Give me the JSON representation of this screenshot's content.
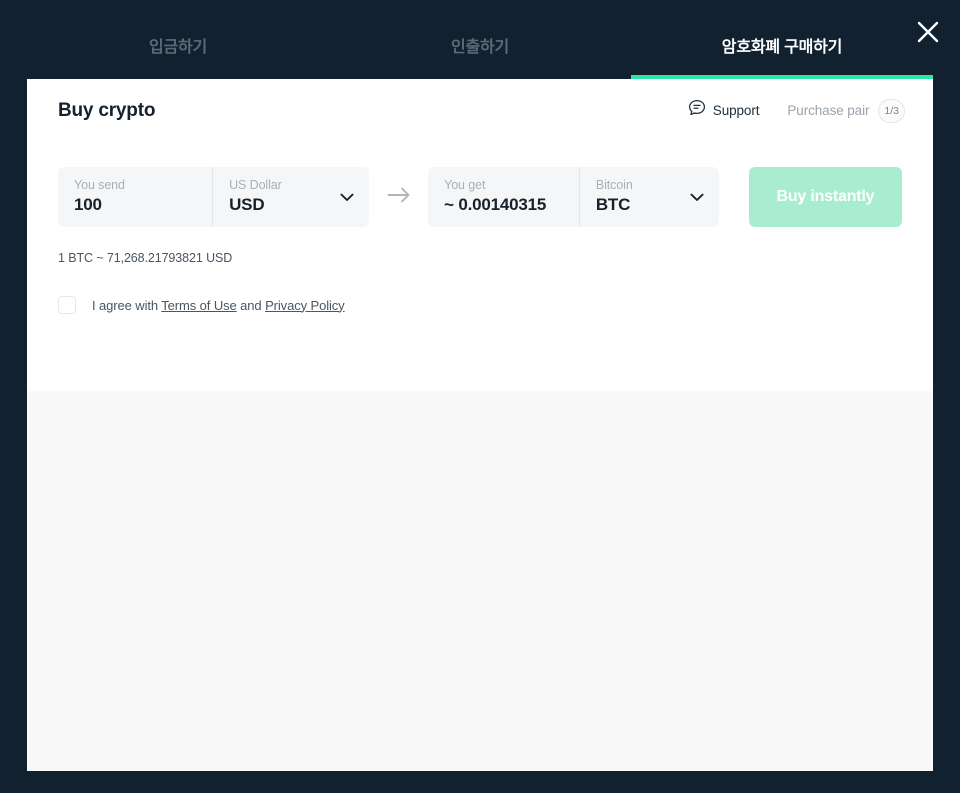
{
  "window": {
    "background_color": "#112130",
    "close_icon": "close-icon"
  },
  "tabs": [
    {
      "label": "입금하기",
      "active": false
    },
    {
      "label": "인출하기",
      "active": false
    },
    {
      "label": "암호화폐 구매하기",
      "active": true
    }
  ],
  "accent_color": "#2ee6a8",
  "header": {
    "title": "Buy crypto",
    "support": {
      "label": "Support",
      "icon": "support-chat-icon"
    },
    "purchase_pair": {
      "label": "Purchase pair",
      "badge": "1/3"
    }
  },
  "form": {
    "send": {
      "amount_label": "You send",
      "amount_value": "100",
      "currency_label": "US Dollar",
      "currency_code": "USD",
      "chevron_icon": "chevron-down-icon"
    },
    "arrow_icon": "arrow-right-icon",
    "get": {
      "amount_label": "You get",
      "amount_value": "~ 0.00140315",
      "currency_label": "Bitcoin",
      "currency_code": "BTC",
      "chevron_icon": "chevron-down-icon"
    },
    "submit_label": "Buy instantly",
    "submit_color": "#a9edd0",
    "submit_disabled": true,
    "rate_line": "1 BTC ~ 71,268.21793821 USD",
    "terms": {
      "prefix": "I agree with ",
      "link_terms": "Terms of Use",
      "middle": " and ",
      "link_privacy": "Privacy Policy",
      "checked": false
    }
  }
}
